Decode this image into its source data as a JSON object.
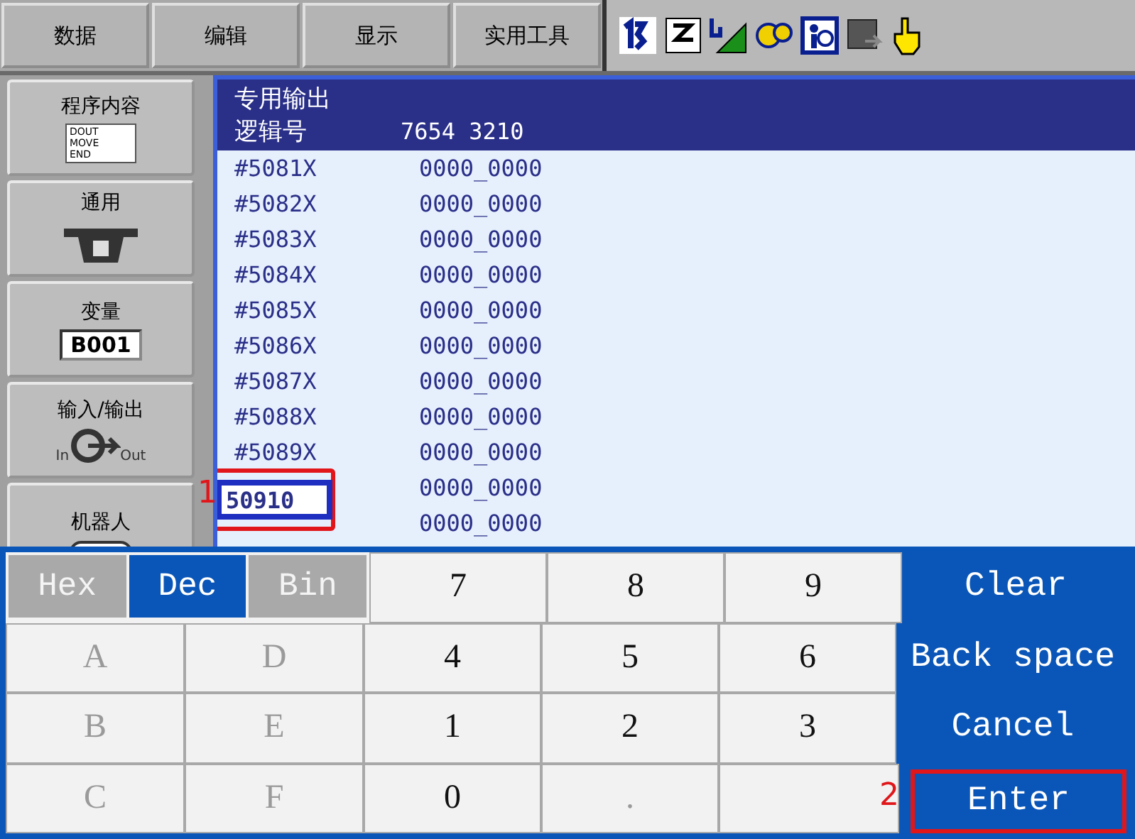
{
  "menu": [
    {
      "label": "数据"
    },
    {
      "label": "编辑"
    },
    {
      "label": "显示"
    },
    {
      "label": "实用工具"
    }
  ],
  "sidebar": [
    {
      "kind": "program",
      "label": "程序内容",
      "icon_text": [
        "DOUT",
        "MOVE",
        "END"
      ]
    },
    {
      "kind": "general",
      "label": "通用"
    },
    {
      "kind": "variable",
      "label": "变量",
      "icon_text": [
        "B001"
      ]
    },
    {
      "kind": "io",
      "label": "输入/输出",
      "icon_text": [
        "In",
        "Out"
      ]
    },
    {
      "kind": "robot",
      "label": "机器人"
    }
  ],
  "panel": {
    "title": "专用输出",
    "column_1": "逻辑号",
    "column_2": "7654 3210"
  },
  "rows": [
    {
      "label": "#5081X",
      "value": "0000_0000"
    },
    {
      "label": "#5082X",
      "value": "0000_0000"
    },
    {
      "label": "#5083X",
      "value": "0000_0000"
    },
    {
      "label": "#5084X",
      "value": "0000_0000"
    },
    {
      "label": "#5085X",
      "value": "0000_0000"
    },
    {
      "label": "#5086X",
      "value": "0000_0000"
    },
    {
      "label": "#5087X",
      "value": "0000_0000"
    },
    {
      "label": "#5088X",
      "value": "0000_0000"
    },
    {
      "label": "#5089X",
      "value": "0000_0000"
    },
    {
      "value": "0000_0000"
    },
    {
      "value": "0000_0000"
    }
  ],
  "input": {
    "value": "50910",
    "marker": "1"
  },
  "keypad": {
    "modes": [
      {
        "label": "Hex",
        "selected": false
      },
      {
        "label": "Dec",
        "selected": true
      },
      {
        "label": "Bin",
        "selected": false
      }
    ],
    "keys": [
      {
        "label": "7",
        "disabled": false
      },
      {
        "label": "8",
        "disabled": false
      },
      {
        "label": "9",
        "disabled": false
      },
      {
        "label": "A",
        "disabled": true
      },
      {
        "label": "D",
        "disabled": true
      },
      {
        "label": "4",
        "disabled": false
      },
      {
        "label": "5",
        "disabled": false
      },
      {
        "label": "6",
        "disabled": false
      },
      {
        "label": "B",
        "disabled": true
      },
      {
        "label": "E",
        "disabled": true
      },
      {
        "label": "1",
        "disabled": false
      },
      {
        "label": "2",
        "disabled": false
      },
      {
        "label": "3",
        "disabled": false
      },
      {
        "label": "C",
        "disabled": true
      },
      {
        "label": "F",
        "disabled": true
      },
      {
        "label": "0",
        "disabled": false
      },
      {
        "label": ".",
        "disabled": true
      }
    ],
    "actions": [
      {
        "label": "Clear",
        "highlighted": false
      },
      {
        "label": "Back space",
        "highlighted": false
      },
      {
        "label": "Cancel",
        "highlighted": false
      },
      {
        "label": "Enter",
        "highlighted": true
      }
    ],
    "marker": "2"
  }
}
